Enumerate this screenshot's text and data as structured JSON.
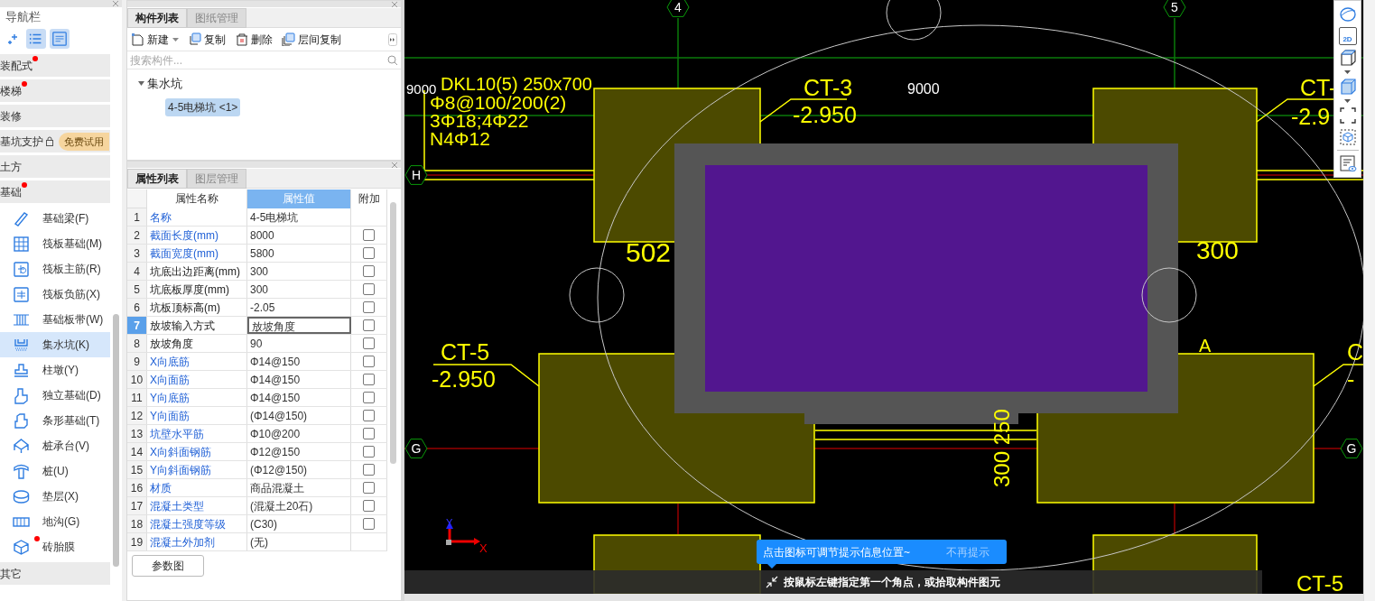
{
  "nav": {
    "title": "导航栏",
    "tools": [
      {
        "selected": false
      },
      {
        "selected": true
      },
      {
        "selected": true
      }
    ],
    "categories": [
      {
        "label": "装配式",
        "dot": true
      },
      {
        "label": "楼梯",
        "dot": true
      },
      {
        "label": "装修",
        "dot": false
      },
      {
        "label": "基坑支护",
        "dot": false,
        "locked": true,
        "badge": "免费试用"
      },
      {
        "label": "土方",
        "dot": false
      },
      {
        "label": "基础",
        "dot": true,
        "children": [
          {
            "label": "基础梁(F)",
            "kind": "beam",
            "selected": false,
            "dot": false
          },
          {
            "label": "筏板基础(M)",
            "kind": "raft",
            "selected": false,
            "dot": false
          },
          {
            "label": "筏板主筋(R)",
            "kind": "raft-main",
            "selected": false,
            "dot": false
          },
          {
            "label": "筏板负筋(X)",
            "kind": "raft-neg",
            "selected": false,
            "dot": false
          },
          {
            "label": "基础板带(W)",
            "kind": "strip",
            "selected": false,
            "dot": false
          },
          {
            "label": "集水坑(K)",
            "kind": "pit",
            "selected": true,
            "dot": false
          },
          {
            "label": "柱墩(Y)",
            "kind": "pier",
            "selected": false,
            "dot": false
          },
          {
            "label": "独立基础(D)",
            "kind": "isolated",
            "selected": false,
            "dot": false
          },
          {
            "label": "条形基础(T)",
            "kind": "strip-found",
            "selected": false,
            "dot": false
          },
          {
            "label": "桩承台(V)",
            "kind": "cap",
            "selected": false,
            "dot": false
          },
          {
            "label": "桩(U)",
            "kind": "pile",
            "selected": false,
            "dot": false
          },
          {
            "label": "垫层(X)",
            "kind": "cushion",
            "selected": false,
            "dot": false
          },
          {
            "label": "地沟(G)",
            "kind": "trench",
            "selected": false,
            "dot": false
          },
          {
            "label": "砖胎膜",
            "kind": "brick",
            "selected": false,
            "dot": true
          }
        ]
      },
      {
        "label": "其它",
        "dot": false
      }
    ]
  },
  "component_panel": {
    "tabs": [
      {
        "label": "构件列表",
        "selected": true
      },
      {
        "label": "图纸管理",
        "selected": false
      }
    ],
    "toolbar": [
      {
        "label": "新建",
        "kind": "new",
        "dropdown": true
      },
      {
        "label": "复制",
        "kind": "copy",
        "dropdown": false
      },
      {
        "label": "删除",
        "kind": "delete",
        "dropdown": false
      },
      {
        "label": "层间复制",
        "kind": "floor-copy",
        "dropdown": false
      }
    ],
    "search": {
      "placeholder": "搜索构件..."
    },
    "tree": [
      {
        "label": "集水坑",
        "expanded": true,
        "children": [
          {
            "label": "4-5电梯坑 <1>",
            "selected": true
          }
        ]
      }
    ]
  },
  "property_panel": {
    "tabs": [
      {
        "label": "属性列表",
        "selected": true
      },
      {
        "label": "图层管理",
        "selected": false
      }
    ],
    "columns": [
      {
        "label": "属性名称",
        "selected": false
      },
      {
        "label": "属性值",
        "selected": true
      },
      {
        "label": "附加",
        "selected": false
      }
    ],
    "rows": [
      {
        "no": "1",
        "name": "名称",
        "value": "4-5电梯坑",
        "public": true,
        "selected": false
      },
      {
        "no": "2",
        "name": "截面长度(mm)",
        "value": "8000",
        "public": true,
        "selected": false,
        "checked": false
      },
      {
        "no": "3",
        "name": "截面宽度(mm)",
        "value": "5800",
        "public": true,
        "selected": false,
        "checked": false
      },
      {
        "no": "4",
        "name": "坑底出边距离(mm)",
        "value": "300",
        "public": false,
        "selected": false,
        "checked": false
      },
      {
        "no": "5",
        "name": "坑底板厚度(mm)",
        "value": "300",
        "public": false,
        "selected": false,
        "checked": false
      },
      {
        "no": "6",
        "name": "坑板顶标高(m)",
        "value": "-2.05",
        "public": false,
        "selected": false,
        "checked": false
      },
      {
        "no": "7",
        "name": "放坡输入方式",
        "value": "放坡角度",
        "public": false,
        "selected": true,
        "checked": false
      },
      {
        "no": "8",
        "name": "放坡角度",
        "value": "90",
        "public": false,
        "selected": false,
        "checked": false
      },
      {
        "no": "9",
        "name": "X向底筋",
        "value": "Φ14@150",
        "public": true,
        "selected": false,
        "checked": false
      },
      {
        "no": "10",
        "name": "X向面筋",
        "value": "Φ14@150",
        "public": true,
        "selected": false,
        "checked": false
      },
      {
        "no": "11",
        "name": "Y向底筋",
        "value": "Φ14@150",
        "public": true,
        "selected": false,
        "checked": false
      },
      {
        "no": "12",
        "name": "Y向面筋",
        "value": "(Φ14@150)",
        "public": true,
        "selected": false,
        "checked": false
      },
      {
        "no": "13",
        "name": "坑壁水平筋",
        "value": "Φ10@200",
        "public": true,
        "selected": false,
        "checked": false
      },
      {
        "no": "14",
        "name": "X向斜面钢筋",
        "value": "Φ12@150",
        "public": true,
        "selected": false,
        "checked": false
      },
      {
        "no": "15",
        "name": "Y向斜面钢筋",
        "value": "(Φ12@150)",
        "public": true,
        "selected": false,
        "checked": false
      },
      {
        "no": "16",
        "name": "材质",
        "value": "商品混凝土",
        "public": true,
        "selected": false,
        "checked": false
      },
      {
        "no": "17",
        "name": "混凝土类型",
        "value": "(混凝土20石)",
        "public": true,
        "selected": false,
        "checked": false
      },
      {
        "no": "18",
        "name": "混凝土强度等级",
        "value": "(C30)",
        "public": true,
        "selected": false,
        "checked": false
      },
      {
        "no": "19",
        "name": "混凝土外加剂",
        "value": "(无)",
        "public": true,
        "selected": false
      }
    ],
    "button": "参数图"
  },
  "canvas": {
    "axes": [
      "4",
      "5",
      "H",
      "G",
      "G"
    ],
    "labels": [
      {
        "text": "9000",
        "kind": "dimension"
      },
      {
        "text": "DKL10(5) 250x700",
        "kind": "note"
      },
      {
        "text": "CT-3",
        "kind": "tag"
      },
      {
        "text": "9000",
        "kind": "dimension"
      },
      {
        "text": "CT-",
        "kind": "tag"
      },
      {
        "text": "Φ8@100/200(2)",
        "kind": "note"
      },
      {
        "text": "3Φ18;4Φ22",
        "kind": "note"
      },
      {
        "text": "-2.950",
        "kind": "tag"
      },
      {
        "text": "-2.9",
        "kind": "tag"
      },
      {
        "text": "N4Φ12",
        "kind": "note"
      },
      {
        "text": "502",
        "kind": "size"
      },
      {
        "text": "300",
        "kind": "size"
      },
      {
        "text": "CT-5",
        "kind": "tag"
      },
      {
        "text": "A",
        "kind": "tag"
      },
      {
        "text": "C",
        "kind": "tag"
      },
      {
        "text": "-2.950",
        "kind": "tag"
      },
      {
        "text": "-",
        "kind": "tag"
      },
      {
        "text": "300 250",
        "kind": "size"
      },
      {
        "text": "CT-5",
        "kind": "tag"
      }
    ],
    "ucs": [
      "Y",
      "X"
    ],
    "tip": {
      "text": "点击图标可调节提示信息位置~",
      "dismiss": "不再提示"
    },
    "status": "按鼠标左键指定第一个角点，或拾取构件图元",
    "toolbar": [
      {
        "kind": "sphere"
      },
      {
        "kind": "view-2d",
        "label": "2D"
      },
      {
        "kind": "cube",
        "dropdown": true
      },
      {
        "kind": "cube-filled",
        "dropdown": true
      },
      {
        "kind": "frame"
      },
      {
        "kind": "frame-cube"
      },
      {
        "kind": "doc-eye",
        "divider": true
      }
    ]
  }
}
